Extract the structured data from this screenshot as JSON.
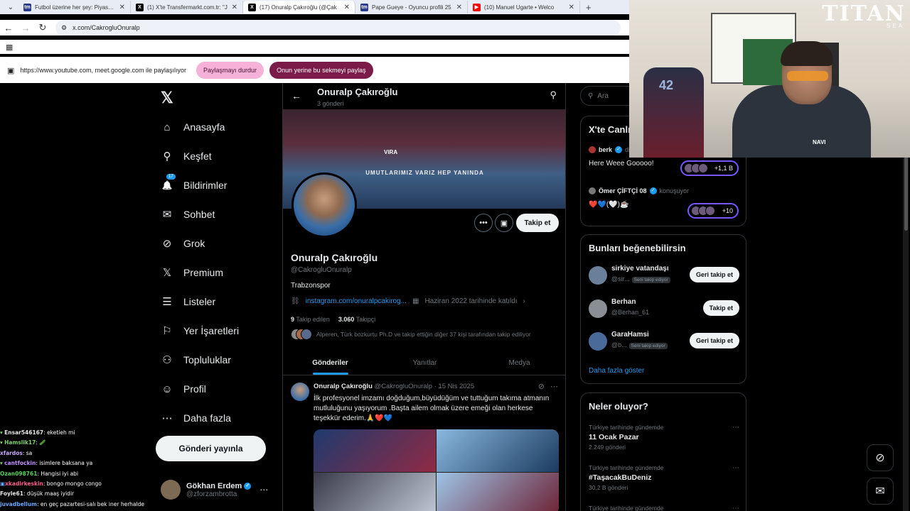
{
  "browser": {
    "tabs": [
      {
        "title": "Futbol üzerine her şey: Piyasa D",
        "fav": "tm",
        "fav_color": "#2b3a8a",
        "active": false
      },
      {
        "title": "(1) X'te Transfermarkt.com.tr: \"J",
        "fav": "X",
        "fav_color": "#000000",
        "active": false
      },
      {
        "title": "(17) Onuralp Çakıroğlu (@Çak",
        "fav": "X",
        "fav_color": "#000000",
        "active": true
      },
      {
        "title": "Pape Gueye - Oyuncu profili 25",
        "fav": "tm",
        "fav_color": "#2b3a8a",
        "active": false
      },
      {
        "title": "(10) Manuel Ugarte • Welco",
        "fav": "▶",
        "fav_color": "#ff0000",
        "active": false
      }
    ],
    "url": "x.com/CakrogluOnuralp",
    "share_text": "https://www.youtube.com, meet.google.com ile paylaşılıyor",
    "share_stop": "Paylaşmayı durdur",
    "share_instead": "Onun yerine bu sekmeyi paylaş"
  },
  "nav": {
    "items": [
      {
        "label": "Anasayfa",
        "icon": "⌂",
        "name": "home"
      },
      {
        "label": "Keşfet",
        "icon": "⚲",
        "name": "explore"
      },
      {
        "label": "Bildirimler",
        "icon": "🔔",
        "name": "notifications",
        "badge": "17"
      },
      {
        "label": "Sohbet",
        "icon": "✉",
        "name": "chat"
      },
      {
        "label": "Grok",
        "icon": "⊘",
        "name": "grok"
      },
      {
        "label": "Premium",
        "icon": "𝕏",
        "name": "premium"
      },
      {
        "label": "Listeler",
        "icon": "☰",
        "name": "lists"
      },
      {
        "label": "Yer İşaretleri",
        "icon": "⚐",
        "name": "bookmarks"
      },
      {
        "label": "Topluluklar",
        "icon": "⚇",
        "name": "communities"
      },
      {
        "label": "Profil",
        "icon": "☺",
        "name": "profile"
      },
      {
        "label": "Daha fazla",
        "icon": "⋯",
        "name": "more"
      }
    ],
    "post_button": "Gönderi yayınla",
    "user_name": "Gökhan Erdem",
    "user_handle": "@zforzambrotta"
  },
  "chat": [
    {
      "user": "Ensar546167",
      "msg": ": eketieh mi",
      "color": "#e6e6e6",
      "prefix": "▾"
    },
    {
      "user": "Hamslik17",
      "msg": ": 🥒",
      "color": "#7fd36b",
      "prefix": "▾"
    },
    {
      "user": "xfardos",
      "msg": ": sa",
      "color": "#c9a8ff",
      "prefix": ""
    },
    {
      "user": "cantfockin",
      "msg": ": isimlere baksana ya",
      "color": "#c38cff",
      "prefix": "▾"
    },
    {
      "user": "Ozan098761",
      "msg": ": Hangisi iyi abi",
      "color": "#5ad25a",
      "prefix": ""
    },
    {
      "user": "xkadirkeskin",
      "msg": ": bongo mongo congo",
      "color": "#ff5a8a",
      "prefix": "▣"
    },
    {
      "user": "Foyle61",
      "msg": ": düşük maaş iyidir",
      "color": "#e6e6e6",
      "prefix": ""
    },
    {
      "user": "juvadbellum",
      "msg": ": en geç pazartesi-salı bek iner herhalde",
      "color": "#6aa8ff",
      "prefix": ""
    }
  ],
  "profile": {
    "header_name": "Onuralp Çakıroğlu",
    "header_posts": "3 gönderi",
    "banner_text": "UMUTLARIMIZ VARIZ HEP YANINDA",
    "banner_vira": "VIRA",
    "follow_button": "Takip et",
    "name": "Onuralp Çakıroğlu",
    "handle": "@CakrogluOnuralp",
    "bio": "Trabzonspor",
    "link": "instagram.com/onuralpcakirog...",
    "joined": "Haziran 2022 tarihinde katıldı",
    "following_count": "9",
    "following_label": "Takip edilen",
    "followers_count": "3.060",
    "followers_label": "Takipçi",
    "followed_by": "Alperen, Türk bozkurtu Ph.D ve takip ettiğin diğer 37 kişi tarafından takip ediliyor",
    "tabs": [
      "Gönderiler",
      "Yanıtlar",
      "Medya"
    ]
  },
  "tweet": {
    "name": "Onuralp Çakıroğlu",
    "handle": "@CakrogluOnuralp",
    "date": "· 15 Nis 2025",
    "text": "İlk profesyonel imzamı doğduğum,büyüdüğüm ve tuttuğum takıma atmanın mutluluğunu yaşıyorum .Başta ailem olmak üzere emeği olan herkese teşekkür ederim.🙏❤️💙"
  },
  "right": {
    "search_placeholder": "Ara",
    "live_title": "X'te Canlı",
    "live1_user": "berk",
    "live1_sub": "di",
    "live1_msg": "Here Weee Gooooo!",
    "live1_count": "+1,1 B",
    "live2_user": "Ömer ÇİFTÇİ 08",
    "live2_sub": "konuşuyor",
    "live2_msg": "❤️💙(🤍)☕",
    "live2_count": "+10",
    "suggest_title": "Bunları beğenebilirsin",
    "suggestions": [
      {
        "name": "sirkiye vatandaşı",
        "handle": "@sir...",
        "follows_you": "Seni takip ediyor",
        "button": "Geri takip et"
      },
      {
        "name": "Berhan",
        "handle": "@Berhan_61",
        "follows_you": "",
        "button": "Takip et"
      },
      {
        "name": "GaraHamsi",
        "handle": "@b...",
        "follows_you": "Seni takip ediyor",
        "button": "Geri takip et"
      }
    ],
    "show_more": "Daha fazla göster",
    "trends_title": "Neler oluyor?",
    "trends": [
      {
        "category": "Türkiye tarihinde gündemde",
        "name": "11 Ocak Pazar",
        "count": "2.249 gönderi"
      },
      {
        "category": "Türkiye tarihinde gündemde",
        "name": "#TaşacakBuDeniz",
        "count": "30,2 B gönderi"
      },
      {
        "category": "Türkiye tarihinde gündemde",
        "name": "",
        "count": ""
      }
    ]
  },
  "webcam": {
    "logo": "TITAN",
    "logo_sub": "SEA",
    "jersey": "42",
    "shirt_text": "NAVI"
  }
}
